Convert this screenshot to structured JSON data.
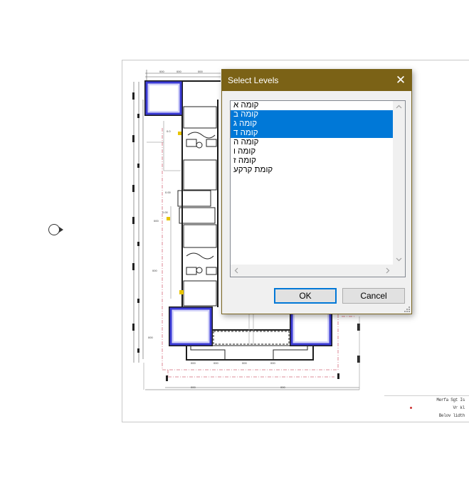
{
  "dialog": {
    "title": "Select Levels",
    "close_glyph": "✕",
    "levels": [
      {
        "label": "קומה א",
        "selected": false
      },
      {
        "label": "קומה ב",
        "selected": true
      },
      {
        "label": "קומה ג",
        "selected": true
      },
      {
        "label": "קומה ד",
        "selected": true
      },
      {
        "label": "קומה ה",
        "selected": false
      },
      {
        "label": "קומה ו",
        "selected": false
      },
      {
        "label": "קומה ז",
        "selected": false
      },
      {
        "label": "קומת קרקע",
        "selected": false
      }
    ],
    "ok_label": "OK",
    "cancel_label": "Cancel",
    "selection_color": "#0078d7",
    "titlebar_color": "#7b6216"
  },
  "titleblock": {
    "lines": [
      "Merfa Sgt Is",
      "Vr kl",
      "Belov lidth"
    ]
  },
  "icons": {
    "scroll_up": "chevron-up-icon",
    "scroll_down": "chevron-down-icon",
    "scroll_left": "chevron-left-icon",
    "scroll_right": "chevron-right-icon",
    "close": "close-icon",
    "view_marker": "view-marker-icon"
  }
}
